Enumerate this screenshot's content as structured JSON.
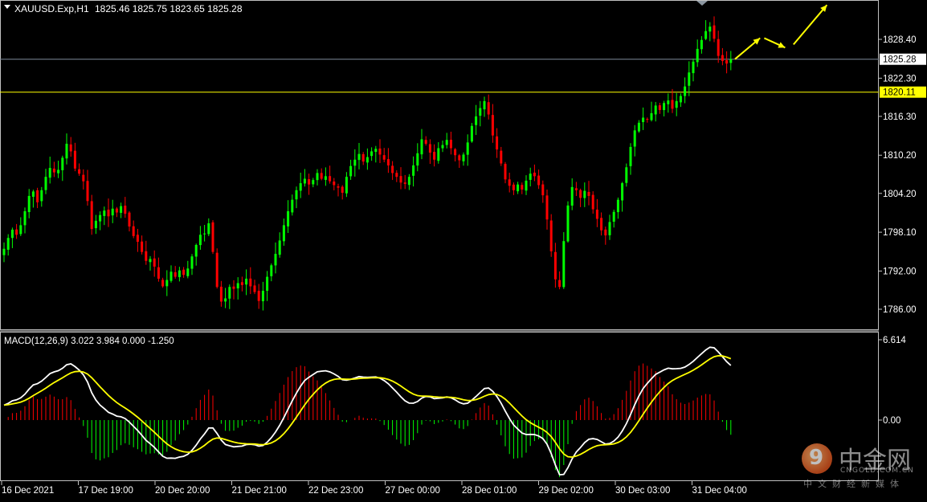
{
  "chart_data": [
    {
      "type": "candlestick",
      "title": "XAUUSD.Exp,H1",
      "ohlc_header": "1825.46 1825.75 1823.65 1825.28",
      "ylim": [
        1783.5,
        1832.5
      ],
      "y_ticks": [
        "1828.40",
        "1822.30",
        "1816.30",
        "1810.20",
        "1804.20",
        "1798.10",
        "1792.00",
        "1786.00"
      ],
      "x_ticks": [
        "16 Dec 2021",
        "17 Dec 19:00",
        "20 Dec 20:00",
        "21 Dec 21:00",
        "22 Dec 23:00",
        "27 Dec 00:00",
        "28 Dec 01:00",
        "29 Dec 02:00",
        "30 Dec 03:00",
        "31 Dec 04:00"
      ],
      "grid": false,
      "current_price": "1825.28",
      "level_line": "1820.11",
      "up_color": "#00ff00",
      "down_color": "#ff0000",
      "level_color": "#ffff00",
      "forecast_color": "#ffff00",
      "forecast_arrows": [
        {
          "from": [
            175,
            1825.3
          ],
          "to": [
            181,
            1828.6
          ]
        },
        {
          "from": [
            182,
            1828.6
          ],
          "to": [
            187,
            1827.1
          ]
        },
        {
          "from": [
            189,
            1827.6
          ],
          "to": [
            197,
            1833.8
          ]
        }
      ],
      "closes": [
        1795.5,
        1797.2,
        1798.5,
        1797.7,
        1799.2,
        1801.4,
        1803.8,
        1804.5,
        1802.8,
        1804.7,
        1806.8,
        1808.2,
        1807.5,
        1807.9,
        1809.8,
        1812.0,
        1810.8,
        1808.1,
        1807.3,
        1806.1,
        1803.0,
        1798.6,
        1799.9,
        1800.8,
        1801.5,
        1800.6,
        1801.8,
        1801.2,
        1802.2,
        1801.0,
        1799.0,
        1797.5,
        1796.6,
        1795.0,
        1793.6,
        1793.9,
        1792.7,
        1790.8,
        1789.6,
        1790.6,
        1791.9,
        1791.1,
        1792.1,
        1791.4,
        1792.4,
        1794.3,
        1796.1,
        1797.7,
        1797.9,
        1799.5,
        1795.0,
        1789.5,
        1787.2,
        1787.7,
        1789.5,
        1789.2,
        1790.1,
        1789.8,
        1790.8,
        1789.6,
        1788.7,
        1787.3,
        1788.9,
        1791.1,
        1792.9,
        1794.7,
        1796.8,
        1799.2,
        1801.4,
        1803.2,
        1804.7,
        1805.8,
        1806.5,
        1805.6,
        1806.3,
        1807.4,
        1806.5,
        1806.9,
        1806.1,
        1805.5,
        1805.1,
        1804.3,
        1806.8,
        1808.5,
        1809.5,
        1810.4,
        1809.2,
        1809.9,
        1810.8,
        1811.2,
        1810.3,
        1809.5,
        1808.6,
        1807.4,
        1806.8,
        1805.9,
        1805.7,
        1806.8,
        1808.6,
        1810.5,
        1812.7,
        1812.0,
        1810.6,
        1809.5,
        1811.3,
        1811.8,
        1812.6,
        1811.3,
        1810.2,
        1809.4,
        1810.3,
        1812.2,
        1814.8,
        1816.3,
        1817.6,
        1818.7,
        1816.6,
        1813.3,
        1811.1,
        1808.9,
        1806.4,
        1805.4,
        1804.7,
        1805.6,
        1804.8,
        1806.2,
        1807.3,
        1806.9,
        1805.5,
        1803.9,
        1800.1,
        1795.1,
        1790.7,
        1789.5,
        1796.7,
        1802.3,
        1805.2,
        1804.7,
        1803.5,
        1804.6,
        1803.8,
        1801.7,
        1800.2,
        1798.4,
        1797.6,
        1799.7,
        1801.3,
        1803.2,
        1805.8,
        1808.3,
        1811.5,
        1814.1,
        1815.3,
        1816.1,
        1815.8,
        1816.8,
        1818.0,
        1817.3,
        1818.4,
        1818.8,
        1817.5,
        1818.7,
        1819.5,
        1821.0,
        1823.2,
        1824.9,
        1826.9,
        1828.3,
        1829.7,
        1830.4,
        1828.5,
        1825.8,
        1825.0,
        1824.6,
        1825.28
      ]
    },
    {
      "type": "line",
      "title": "MACD(12,26,9) 3.022 3.984 0.000 -1.250",
      "y_ticks": [
        "6.614",
        "0.00",
        "-7.84"
      ],
      "ylim": [
        -9.0,
        6.614
      ],
      "series": [
        {
          "name": "",
          "color": "#ffffff"
        },
        {
          "name": "",
          "color": "#ffff00"
        },
        {
          "name": "",
          "color": "#00ff00"
        },
        {
          "name": "",
          "color": "#ff0000"
        }
      ]
    }
  ],
  "watermark": {
    "logo_glyph": "9",
    "name_cn": "中金网",
    "name_en": "CNGOLD.COM.CN",
    "tagline_cn": "中文财经新媒体"
  }
}
